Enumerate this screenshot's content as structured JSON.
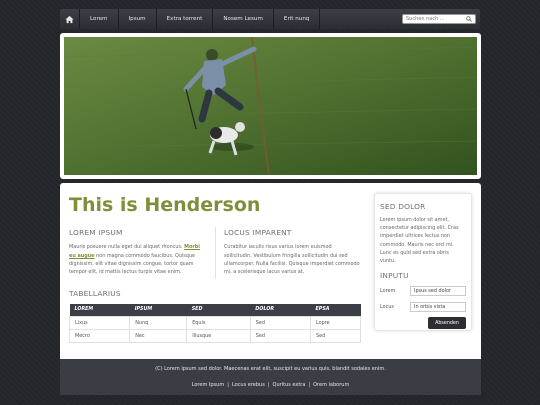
{
  "nav": {
    "items": [
      "Lorem",
      "Ipsum",
      "Extra torrent",
      "Nosem Lesum",
      "Erit nunq"
    ],
    "search_placeholder": "Suchen nach ..."
  },
  "main": {
    "title": "This is Henderson",
    "col1": {
      "heading": "LOREM IPSUM",
      "text_before": "Mauris posuere nulla eget dui aliquet rhoncus. ",
      "highlight": "Morbi eu augue",
      "text_after": " non magna commodo faucibus. Quisque dignissim, elit vitae dignissim congue, tortor quam tempor elit, id mattis lectus turpis vitae enim."
    },
    "col2": {
      "heading": "LOCUS IMPARENT",
      "text": "Curabitur iaculis risus varius lorem euismod sollicitudin. Vestibulum fringilla sollicitudin dui sed ullamcorper. Nulla facilisi. Quisque imperdiet commodo mi, a scelerisque lacus varius at."
    },
    "table": {
      "title": "TABELLARIUS",
      "headers": [
        "LOREM",
        "IPSUM",
        "SED",
        "DOLOR",
        "EPSA"
      ],
      "rows": [
        [
          "Lixus",
          "Nunq",
          "Equis",
          "Sed",
          "Lopre"
        ],
        [
          "Mecro",
          "Nec",
          "Illusque",
          "Sed",
          "Sed"
        ]
      ]
    }
  },
  "sidebar": {
    "heading1": "SED DOLOR",
    "text": "Lorem ipsum dolor sit amet, consectetur adipiscing elit. Cras imperdiet ultrices lectus non commodo. Mauris nec orci mi. Lunc es quid sed extra obris vuntu.",
    "heading2": "INPUTU",
    "form": [
      {
        "label": "Lorem",
        "value": "Ipsus sed dolor"
      },
      {
        "label": "Locus",
        "value": "In orbis vista"
      }
    ],
    "submit": "Absenden"
  },
  "footer": {
    "copyright": "(C) Lorem ipsum sed dolor. Maecenas erat elit, suscipit eu varius quis, blandit sodales enim.",
    "links": [
      "Lorem Ipsum",
      "Locus erebus",
      "Quritus extra",
      "Orem laborum"
    ]
  },
  "colors": {
    "accent": "#7e8f3b",
    "nav_bg": "#33363c",
    "footer_bg": "#3a3d44",
    "page_bg": "#23262b"
  },
  "icons": [
    "home-icon",
    "search-icon"
  ]
}
